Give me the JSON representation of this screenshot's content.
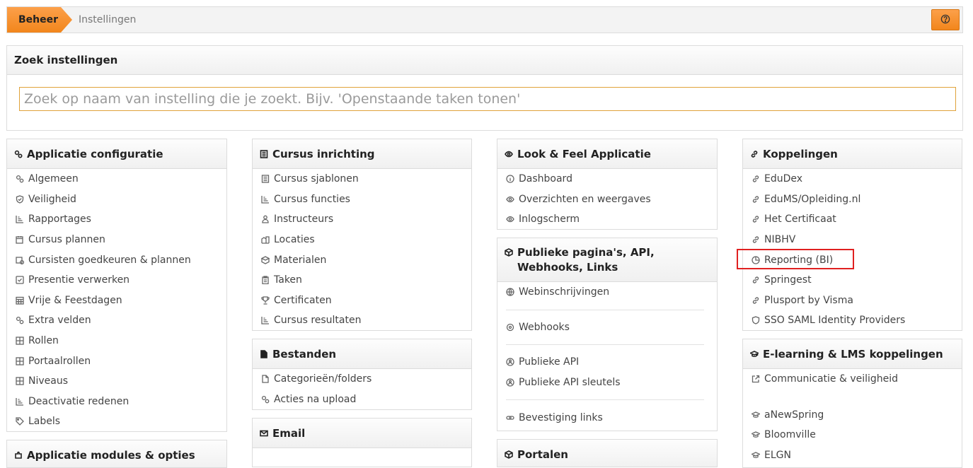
{
  "breadcrumb": {
    "active": "Beheer",
    "current": "Instellingen"
  },
  "search": {
    "title": "Zoek instellingen",
    "placeholder": "Zoek op naam van instelling die je zoekt. Bijv. 'Openstaande taken tonen'",
    "value": ""
  },
  "col1": {
    "applicatie": {
      "title": "Applicatie configuratie",
      "items": [
        "Algemeen",
        "Veiligheid",
        "Rapportages",
        "Cursus plannen",
        "Cursisten goedkeuren & plannen",
        "Presentie verwerken",
        "Vrije & Feestdagen",
        "Extra velden",
        "Rollen",
        "Portaalrollen",
        "Niveaus",
        "Deactivatie redenen",
        "Labels"
      ]
    },
    "modules": {
      "title": "Applicatie modules & opties"
    }
  },
  "col2": {
    "cursus": {
      "title": "Cursus inrichting",
      "items": [
        "Cursus sjablonen",
        "Cursus functies",
        "Instructeurs",
        "Locaties",
        "Materialen",
        "Taken",
        "Certificaten",
        "Cursus resultaten"
      ]
    },
    "bestanden": {
      "title": "Bestanden",
      "items": [
        "Categorieën/folders",
        "Acties na upload"
      ]
    },
    "email": {
      "title": "Email"
    }
  },
  "col3": {
    "look": {
      "title": "Look & Feel Applicatie",
      "items": [
        "Dashboard",
        "Overzichten en weergaves",
        "Inlogscherm"
      ]
    },
    "publiek": {
      "title": "Publieke pagina's, API, Webhooks, Links",
      "items": [
        "Webinschrijvingen",
        "Webhooks",
        "Publieke API",
        "Publieke API sleutels",
        "Bevestiging links"
      ]
    },
    "portalen": {
      "title": "Portalen"
    }
  },
  "col4": {
    "koppelingen": {
      "title": "Koppelingen",
      "items": [
        "EduDex",
        "EduMS/Opleiding.nl",
        "Het Certificaat",
        "NIBHV",
        "Reporting (BI)",
        "Springest",
        "Plusport by Visma",
        "SSO SAML Identity Providers"
      ]
    },
    "elearning": {
      "title": "E-learning & LMS koppelingen",
      "items": [
        "Communicatie & veiligheid",
        "aNewSpring",
        "Bloomville",
        "ELGN"
      ]
    }
  },
  "colors": {
    "accent": "#f5922a",
    "highlight": "#e02020"
  }
}
